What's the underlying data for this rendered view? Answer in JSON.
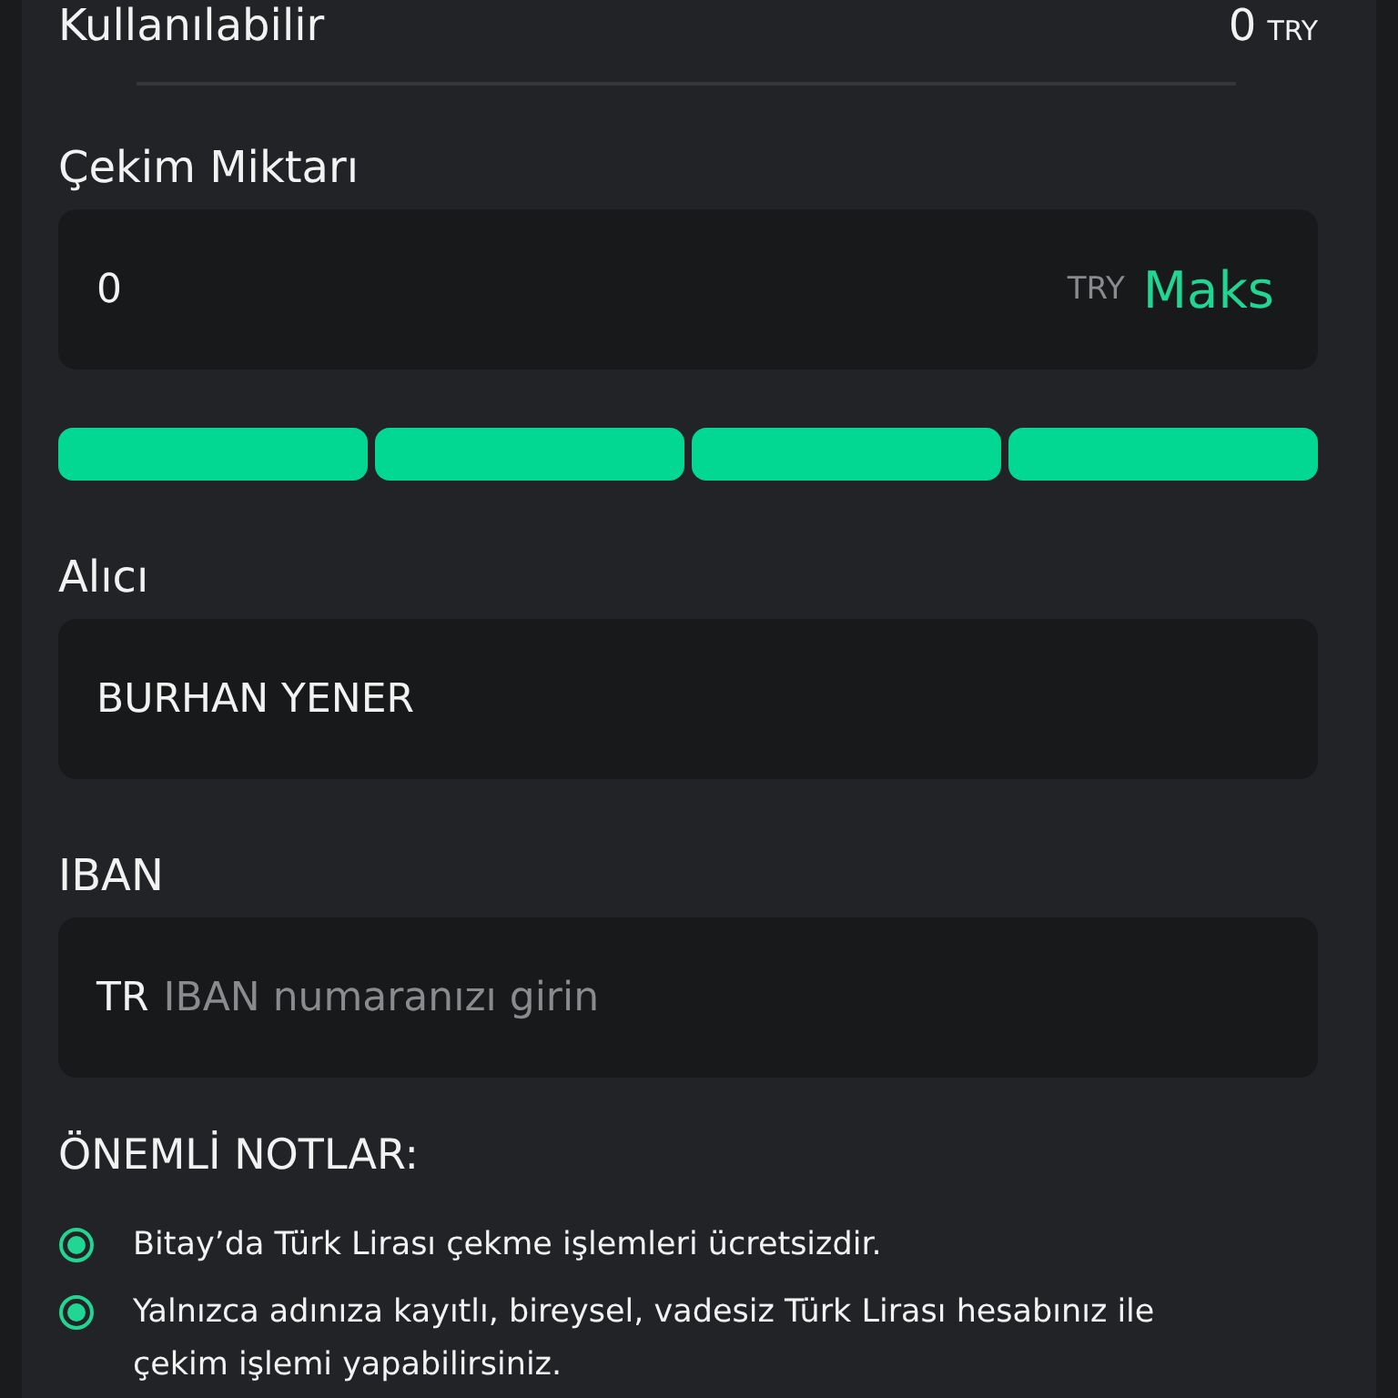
{
  "available": {
    "label": "Kullanılabilir",
    "value": "0",
    "unit": "TRY"
  },
  "amount": {
    "label": "Çekim Miktarı",
    "value": "0",
    "unit": "TRY",
    "max_button": "Maks"
  },
  "segments": [
    {
      "filled": true
    },
    {
      "filled": true
    },
    {
      "filled": true
    },
    {
      "filled": true
    }
  ],
  "recipient": {
    "label": "Alıcı",
    "value": "BURHAN YENER"
  },
  "iban": {
    "label": "IBAN",
    "prefix": "TR",
    "placeholder": "IBAN numaranızı girin"
  },
  "notes": {
    "title": "ÖNEMLİ NOTLAR:",
    "items": [
      "Bitay’da Türk Lirası çekme işlemleri ücretsizdir.",
      "Yalnızca adınıza kayıtlı, bireysel, vadesiz Türk Lirası hesabınız ile çekim işlemi yapabilirsiniz."
    ]
  }
}
